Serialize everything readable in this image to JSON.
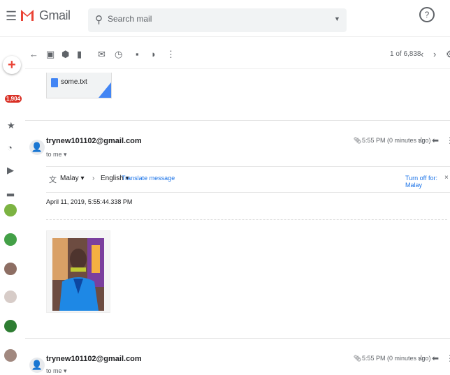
{
  "header": {
    "app_name": "Gmail",
    "search_placeholder": "Search mail"
  },
  "sidebar": {
    "badge_count": "1,904"
  },
  "toolbar": {
    "pager_text": "1 of 6,838"
  },
  "attachment": {
    "file_name": "some.txt"
  },
  "messages": [
    {
      "sender": "trynew101102@gmail.com",
      "to": "to me",
      "time": "5:55 PM (0 minutes ago)"
    },
    {
      "sender": "trynew101102@gmail.com",
      "to": "to me",
      "time": "5:55 PM (0 minutes ago)"
    }
  ],
  "translate": {
    "from_lang": "Malay",
    "to_lang": "English",
    "translate_link": "Translate message",
    "turn_off": "Turn off for: Malay"
  },
  "body": {
    "text": "April 11, 2019, 5:55:44.338 PM"
  },
  "colors": {
    "brand_red": "#ea4335",
    "link_blue": "#1a73e8",
    "badge_red": "#d93025"
  }
}
